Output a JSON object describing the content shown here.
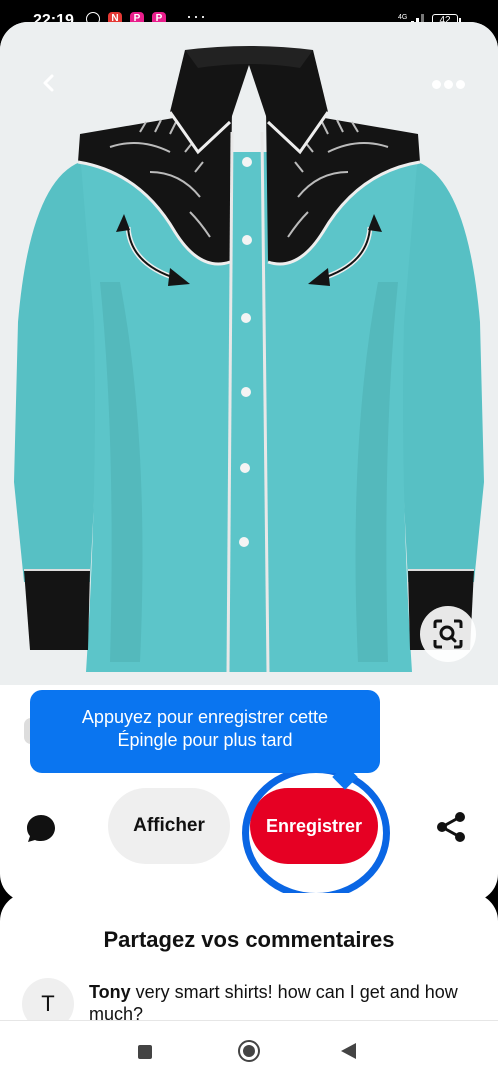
{
  "status_bar": {
    "time": "22:19",
    "more": "···",
    "network": "4G",
    "battery": "42"
  },
  "pin": {
    "image_description": "turquoise western shirt with black embroidered yoke"
  },
  "tooltip": {
    "line1": "Appuyez pour enregistrer cette",
    "line2": "Épingle pour plus tard"
  },
  "actions": {
    "view_label": "Afficher",
    "save_label": "Enregistrer"
  },
  "comments": {
    "title": "Partagez vos commentaires",
    "items": [
      {
        "initial": "T",
        "author": "Tony",
        "text": " very smart shirts! how can I get and how much?"
      }
    ]
  },
  "colors": {
    "save": "#e60023",
    "tooltip": "#0a75f0",
    "ring": "#0a66e4",
    "shirt": "#57c0c4"
  }
}
